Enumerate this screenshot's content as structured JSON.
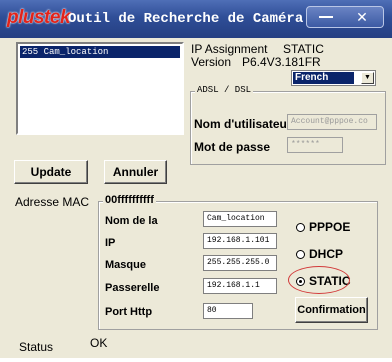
{
  "window": {
    "brand": "plustek",
    "title": "Outil de Recherche de Caméra",
    "close_label": "✕"
  },
  "camera_list": {
    "items": [
      "255 Cam_location"
    ]
  },
  "info": {
    "ip_assignment_label": "IP Assignment",
    "ip_assignment_value": "STATIC",
    "version_label": "Version",
    "version_value": "P6.4V3.181FR"
  },
  "language": {
    "selected": "French"
  },
  "adsl": {
    "group_label": "ADSL / DSL",
    "username_label": "Nom d'utilisateur",
    "username_value": "Account@pppoe.co",
    "password_label": "Mot de passe",
    "password_value": "******"
  },
  "buttons": {
    "update": "Update",
    "cancel": "Annuler",
    "confirm": "Confirmation"
  },
  "network": {
    "mac_label": "Adresse MAC",
    "mac_value": "00ffffffffff",
    "name_label": "Nom de la",
    "name_value": "Cam_location",
    "ip_label": "IP",
    "ip_value": "192.168.1.101",
    "mask_label": "Masque",
    "mask_value": "255.255.255.0",
    "gateway_label": "Passerelle",
    "gateway_value": "192.168.1.1",
    "port_label": "Port Http",
    "port_value": "80"
  },
  "mode": {
    "options": [
      "PPPOE",
      "DHCP",
      "STATIC"
    ],
    "selected": "STATIC"
  },
  "status": {
    "label": "Status",
    "value": "OK"
  },
  "colors": {
    "titlebar": "#2f4e97",
    "brand": "#e2231a",
    "selection": "#0a246a",
    "highlight_circle": "#d23a3a"
  }
}
